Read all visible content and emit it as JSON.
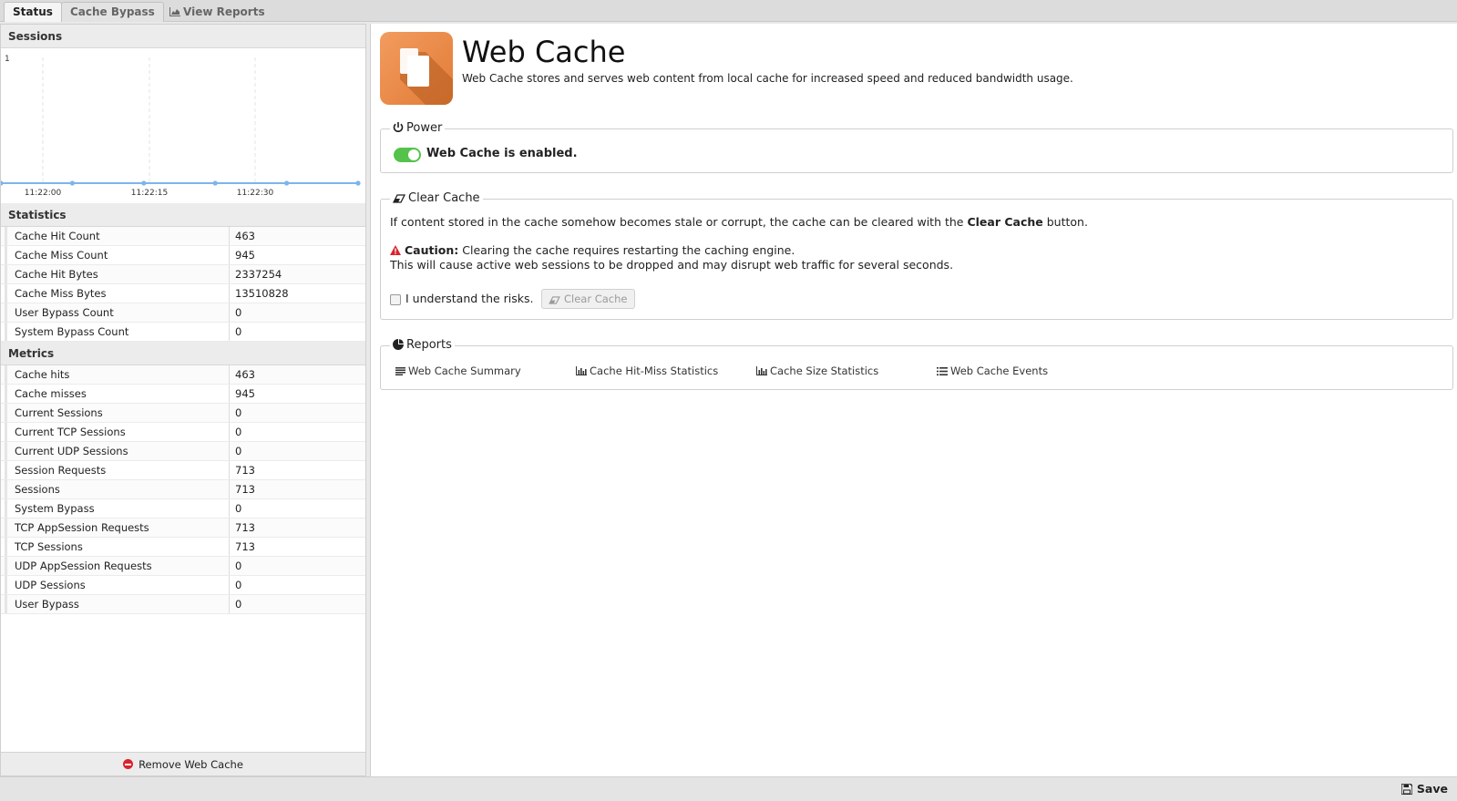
{
  "tabs": [
    {
      "label": "Status",
      "active": true
    },
    {
      "label": "Cache Bypass",
      "active": false
    },
    {
      "label": "View Reports",
      "active": false,
      "icon": "area-chart-icon"
    }
  ],
  "left": {
    "sessions_title": "Sessions",
    "statistics_title": "Statistics",
    "metrics_title": "Metrics",
    "statistics": [
      {
        "label": "Cache Hit Count",
        "value": "463"
      },
      {
        "label": "Cache Miss Count",
        "value": "945"
      },
      {
        "label": "Cache Hit Bytes",
        "value": "2337254"
      },
      {
        "label": "Cache Miss Bytes",
        "value": "13510828"
      },
      {
        "label": "User Bypass Count",
        "value": "0"
      },
      {
        "label": "System Bypass Count",
        "value": "0"
      }
    ],
    "metrics": [
      {
        "label": "Cache hits",
        "value": "463"
      },
      {
        "label": "Cache misses",
        "value": "945"
      },
      {
        "label": "Current Sessions",
        "value": "0"
      },
      {
        "label": "Current TCP Sessions",
        "value": "0"
      },
      {
        "label": "Current UDP Sessions",
        "value": "0"
      },
      {
        "label": "Session Requests",
        "value": "713"
      },
      {
        "label": "Sessions",
        "value": "713"
      },
      {
        "label": "System Bypass",
        "value": "0"
      },
      {
        "label": "TCP AppSession Requests",
        "value": "713"
      },
      {
        "label": "TCP Sessions",
        "value": "713"
      },
      {
        "label": "UDP AppSession Requests",
        "value": "0"
      },
      {
        "label": "UDP Sessions",
        "value": "0"
      },
      {
        "label": "User Bypass",
        "value": "0"
      }
    ],
    "remove_label": "Remove Web Cache"
  },
  "chart_data": {
    "type": "line",
    "title": "",
    "x": [
      "11:22:00",
      "11:22:15",
      "11:22:30"
    ],
    "x_ticks": [
      "11:22:00",
      "11:22:15",
      "11:22:30"
    ],
    "series": [
      {
        "values": [
          0,
          0,
          0,
          0,
          0,
          0
        ]
      }
    ],
    "ylim": [
      0,
      1
    ],
    "y_ticks": [
      "1"
    ],
    "grid": true,
    "color": "#7cb5ec"
  },
  "app": {
    "title": "Web Cache",
    "description": "Web Cache stores and serves web content from local cache for increased speed and reduced bandwidth usage."
  },
  "power": {
    "legend": "Power",
    "status": "Web Cache is enabled.",
    "enabled": true
  },
  "clear_cache": {
    "legend": "Clear Cache",
    "info_prefix": "If content stored in the cache somehow becomes stale or corrupt, the cache can be cleared with the ",
    "info_bold": "Clear Cache",
    "info_suffix": " button.",
    "caution_label": "Caution:",
    "caution_text": " Clearing the cache requires restarting the caching engine.",
    "caution_text2": "This will cause active web sessions to be dropped and may disrupt web traffic for several seconds.",
    "checkbox_label": "I understand the risks.",
    "button_label": "Clear Cache"
  },
  "reports": {
    "legend": "Reports",
    "links": [
      {
        "label": "Web Cache Summary",
        "icon": "list-icon"
      },
      {
        "label": "Cache Hit-Miss Statistics",
        "icon": "bar-chart-icon"
      },
      {
        "label": "Cache Size Statistics",
        "icon": "bar-chart-icon"
      },
      {
        "label": "Web Cache Events",
        "icon": "list-bullets-icon"
      }
    ]
  },
  "footer": {
    "save_label": "Save"
  },
  "colors": {
    "accent": "#55c24b",
    "warning": "#d9232d",
    "app_icon": "#e27b36"
  }
}
